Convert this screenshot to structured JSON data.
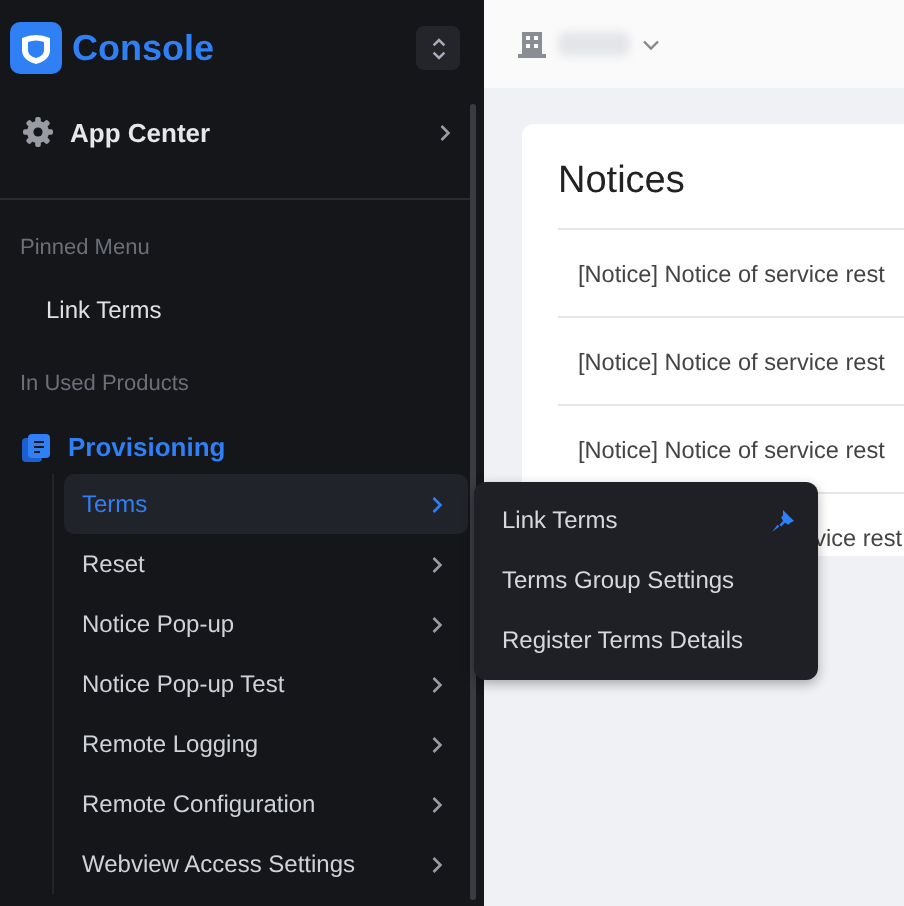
{
  "sidebar": {
    "brand": "Console",
    "app_center": "App Center",
    "sections": [
      {
        "title": "Pinned Menu",
        "items": [
          {
            "label": "Link Terms"
          }
        ]
      },
      {
        "title": "In Used Products",
        "product": "Provisioning",
        "items": [
          {
            "label": "Terms",
            "selected": true
          },
          {
            "label": "Reset",
            "selected": false
          },
          {
            "label": "Notice Pop-up",
            "selected": false
          },
          {
            "label": "Notice Pop-up Test",
            "selected": false
          },
          {
            "label": "Remote Logging",
            "selected": false
          },
          {
            "label": "Remote Configuration",
            "selected": false
          },
          {
            "label": "Webview Access Settings",
            "selected": false
          }
        ]
      }
    ]
  },
  "submenu": {
    "items": [
      {
        "label": "Link Terms",
        "pinned": true
      },
      {
        "label": "Terms Group Settings",
        "pinned": false
      },
      {
        "label": "Register Terms Details",
        "pinned": false
      }
    ]
  },
  "notices": {
    "title": "Notices",
    "rows": [
      {
        "text": "[Notice] Notice of service rest"
      },
      {
        "text": "[Notice] Notice of service rest"
      },
      {
        "text": "[Notice] Notice of service rest"
      },
      {
        "text": "vice rest",
        "partial": true
      }
    ]
  }
}
